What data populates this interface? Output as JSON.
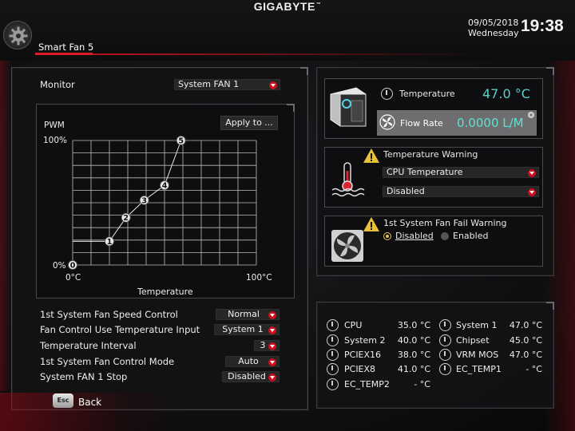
{
  "header": {
    "brand": "GIGABYTE",
    "brand_mark": "™",
    "date": "09/05/2018",
    "weekday": "Wednesday",
    "time": "19:38",
    "tab": "Smart Fan 5"
  },
  "monitor": {
    "label": "Monitor",
    "selected": "System FAN 1"
  },
  "graph": {
    "apply_label": "Apply to ...",
    "y_label": "PWM",
    "y_max_label": "100%",
    "y_min_label": "0%",
    "x_min_label": "0°C",
    "x_max_label": "100°C",
    "x_label": "Temperature",
    "points": [
      {
        "label": "0",
        "temp": 0,
        "pwm": 0
      },
      {
        "label": "1",
        "temp": 20,
        "pwm": 19
      },
      {
        "label": "2",
        "temp": 29,
        "pwm": 38
      },
      {
        "label": "3",
        "temp": 39,
        "pwm": 52
      },
      {
        "label": "4",
        "temp": 50,
        "pwm": 64
      },
      {
        "label": "5",
        "temp": 59,
        "pwm": 100
      }
    ],
    "flat_start_pwm": 19
  },
  "settings": [
    {
      "label": "1st System Fan Speed Control",
      "value": "Normal"
    },
    {
      "label": "Fan Control Use Temperature Input",
      "value": "System 1"
    },
    {
      "label": "Temperature Interval",
      "value": "3"
    },
    {
      "label": "1st System Fan Control Mode",
      "value": "Auto"
    },
    {
      "label": "System FAN 1 Stop",
      "value": "Disabled"
    }
  ],
  "status": {
    "temperature_label": "Temperature",
    "temperature_value": "47.0 °C",
    "flow_label": "Flow Rate",
    "flow_value": "0.0000 L/M"
  },
  "temp_warning": {
    "title": "Temperature Warning",
    "source": "CPU Temperature",
    "state": "Disabled"
  },
  "fan_fail": {
    "title": "1st System Fan Fail Warning",
    "option_disabled": "Disabled",
    "option_enabled": "Enabled",
    "selected": "Disabled"
  },
  "monitor_list": [
    {
      "name": "CPU",
      "value": "35.0 °C"
    },
    {
      "name": "System 1",
      "value": "47.0 °C"
    },
    {
      "name": "System 2",
      "value": "40.0 °C"
    },
    {
      "name": "Chipset",
      "value": "45.0 °C"
    },
    {
      "name": "PCIEX16",
      "value": "38.0 °C"
    },
    {
      "name": "VRM MOS",
      "value": "47.0 °C"
    },
    {
      "name": "PCIEX8",
      "value": "41.0 °C"
    },
    {
      "name": "EC_TEMP1",
      "value": "- °C"
    },
    {
      "name": "EC_TEMP2",
      "value": "- °C"
    }
  ],
  "footer": {
    "esc_label": "Esc",
    "back_label": "Back"
  },
  "colors": {
    "accent_red": "#c8101e",
    "value_teal": "#56d3c6",
    "warning_yellow": "#e6c34a"
  }
}
